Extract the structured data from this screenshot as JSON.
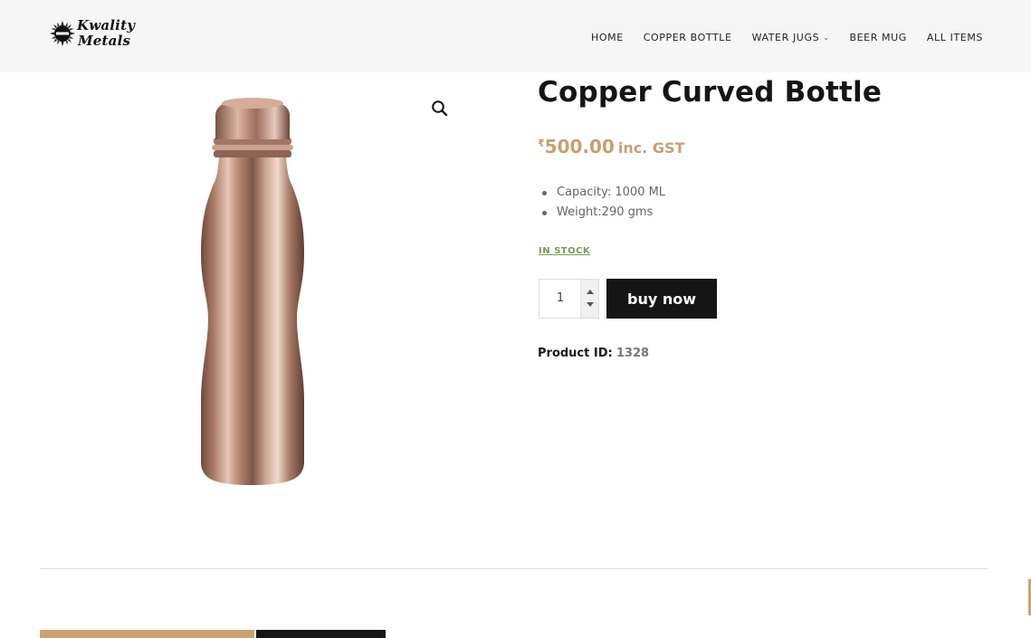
{
  "brand": {
    "logo_line1": "Kwality",
    "logo_line2": "Metals"
  },
  "nav": {
    "items": [
      {
        "label": "HOME"
      },
      {
        "label": "COPPER BOTTLE"
      },
      {
        "label": "WATER JUGS",
        "has_dropdown": true
      },
      {
        "label": "BEER MUG"
      },
      {
        "label": "ALL ITEMS"
      }
    ]
  },
  "product": {
    "title": "Copper Curved Bottle",
    "currency_symbol": "₹",
    "price": "500.00",
    "price_suffix": "inc. GST",
    "specs": [
      "Capacity: 1000 ML",
      "Weight:290 gms"
    ],
    "stock_status": "IN STOCK",
    "quantity": "1",
    "buy_label": "buy now",
    "id_label": "Product ID:",
    "id_value": "1328"
  },
  "icons": {
    "zoom": "magnifier-icon",
    "quantity_up": "caret-up-icon",
    "quantity_down": "caret-down-icon",
    "dropdown": "chevron-down-icon"
  },
  "colors": {
    "accent_gold": "#c9a271",
    "price": "#c8a070",
    "stock": "#7a9a55",
    "button_dark": "#151515",
    "header_bg": "#f6f6f6"
  }
}
